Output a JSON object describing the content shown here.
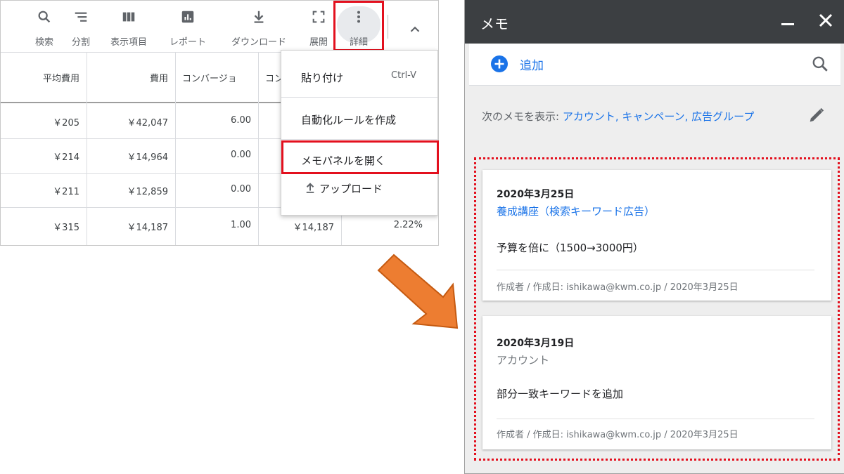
{
  "toolbar": {
    "search": "検索",
    "segment": "分割",
    "columns": "表示項目",
    "report": "レポート",
    "download": "ダウンロード",
    "expand": "展開",
    "more": "詳細"
  },
  "table": {
    "headers": [
      "平均費用",
      "費用",
      "コンバージョ",
      "コン"
    ],
    "rows": [
      [
        "￥205",
        "￥42,047",
        "6.00"
      ],
      [
        "￥214",
        "￥14,964",
        "0.00"
      ],
      [
        "￥211",
        "￥12,859",
        "0.00"
      ],
      [
        "￥315",
        "￥14,187",
        "1.00",
        "￥14,187",
        "2.22%"
      ]
    ]
  },
  "menu": {
    "paste": "貼り付け",
    "paste_shortcut": "Ctrl-V",
    "create_rule": "自動化ルールを作成",
    "open_memo": "メモパネルを開く",
    "upload": "アップロード"
  },
  "memo": {
    "title": "メモ",
    "add": "追加",
    "filter_label": "次のメモを表示: ",
    "filter_links": "アカウント, キャンペーン, 広告グループ",
    "notes": [
      {
        "date": "2020年3月25日",
        "target": "養成講座（検索キーワード広告）",
        "body": "予算を倍に（1500→3000円）",
        "meta": "作成者 / 作成日: ishikawa@kwm.co.jp / 2020年3月25日"
      },
      {
        "date": "2020年3月19日",
        "target": "アカウント",
        "body": "部分一致キーワードを追加",
        "meta": "作成者 / 作成日: ishikawa@kwm.co.jp / 2020年3月25日"
      }
    ]
  },
  "colors": {
    "accent_blue": "#1a73e8",
    "highlight_red": "#e3101e",
    "arrow_orange": "#ed7d31",
    "memo_header": "#3c3f42"
  }
}
